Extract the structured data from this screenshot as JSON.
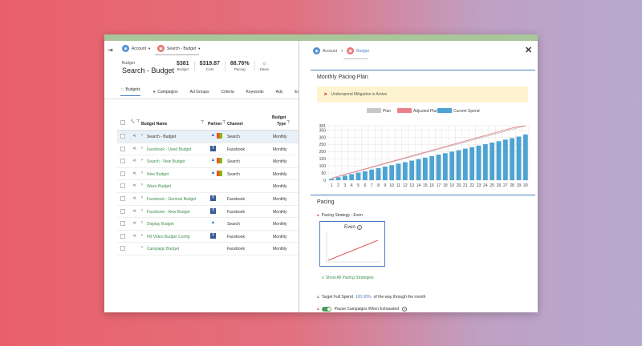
{
  "left_panel": {
    "breadcrumbs": [
      {
        "icon": "account-icon",
        "label": "Account"
      },
      {
        "icon": "budget-icon",
        "label": "Search - Budget"
      }
    ],
    "budget_label": "Budget",
    "budget_name": "Search - Budget",
    "metrics": [
      {
        "value": "$381",
        "label": "Budget"
      },
      {
        "value": "$319.87",
        "label": "Cost"
      },
      {
        "value": "88.76%",
        "label": "Pacing"
      },
      {
        "icon": "dawn-icon",
        "label": "Dawn"
      }
    ],
    "tabs": [
      {
        "label": "Budgets",
        "icon": "star-outline-icon",
        "active": true
      },
      {
        "label": "Campaigns",
        "icon": "star-icon"
      },
      {
        "label": "Ad Groups"
      },
      {
        "label": "Criteria"
      },
      {
        "label": "Keywords"
      },
      {
        "label": "Ads"
      },
      {
        "label": "Ex"
      }
    ],
    "table": {
      "headers": {
        "budget_name": "Budget Name",
        "partner": "Partner",
        "channel": "Channel",
        "budget_type_1": "Budget",
        "budget_type_2": "Type"
      },
      "rows": [
        {
          "name": "Search - Budget",
          "partner": [
            "ads",
            "ms"
          ],
          "channel": "Search",
          "type": "Monthly",
          "selected": true,
          "style": "dark",
          "share": true
        },
        {
          "name": "Facebook - Used Budget",
          "partner": [
            "fb"
          ],
          "channel": "Facebook",
          "type": "Monthly",
          "style": "green",
          "share": true
        },
        {
          "name": "Search - New Budget",
          "partner": [
            "ads",
            "ms"
          ],
          "channel": "Search",
          "type": "Monthly",
          "style": "green",
          "share": true
        },
        {
          "name": "New Budget",
          "partner": [
            "ads",
            "ms"
          ],
          "channel": "Search",
          "type": "Monthly",
          "style": "green",
          "share": true
        },
        {
          "name": "Waze Budget",
          "partner": [],
          "channel": "",
          "type": "Monthly",
          "style": "green",
          "share": true
        },
        {
          "name": "Facebook - General Budget",
          "partner": [
            "fb"
          ],
          "channel": "Facebook",
          "type": "Monthly",
          "style": "green",
          "share": true
        },
        {
          "name": "Facebook - New Budget",
          "partner": [
            "fb"
          ],
          "channel": "Facebook",
          "type": "Monthly",
          "style": "green",
          "share": true
        },
        {
          "name": "Display Budget",
          "partner": [
            "ads"
          ],
          "channel": "Search",
          "type": "Monthly",
          "style": "green",
          "share": true
        },
        {
          "name": "FB Video Budget Config",
          "partner": [
            "fb"
          ],
          "channel": "Facebook",
          "type": "Monthly",
          "style": "green",
          "share": true
        },
        {
          "name": "Campaign Budget",
          "partner": [],
          "channel": "Facebook",
          "type": "Monthly",
          "style": "green",
          "share": false
        }
      ]
    }
  },
  "right_panel": {
    "breadcrumbs": [
      {
        "icon": "account-icon",
        "label": "Account"
      },
      {
        "icon": "budget-icon",
        "label": "Budget"
      }
    ],
    "monthly_title": "Monthly Pacing Plan",
    "warning_text": "Underspend Mitigation is Active",
    "pacing_title": "Pacing",
    "pacing_strategy": "Pacing Strategy - Even",
    "even_label": "Even",
    "show_all_link": "Show All Pacing Strategies",
    "target_prefix": "Target Full Spend",
    "target_pct": "100.00%",
    "target_suffix": "of the way through the month",
    "pause_label": "Pause Campaigns When Exhausted"
  },
  "colors": {
    "plan": "#c8c8c8",
    "adjusted_plan": "#e9808a",
    "current_spend": "#4da3d3"
  },
  "chart_data": {
    "type": "bar",
    "legend": [
      "Plan",
      "Adjusted Plan",
      "Current Spend"
    ],
    "legend_position": "top-center",
    "categories": [
      "1",
      "2",
      "3",
      "4",
      "5",
      "6",
      "7",
      "8",
      "9",
      "10",
      "11",
      "12",
      "13",
      "14",
      "15",
      "16",
      "17",
      "18",
      "19",
      "20",
      "21",
      "22",
      "23",
      "24",
      "25",
      "26",
      "27",
      "28",
      "29",
      "30"
    ],
    "y_ticks": [
      "0",
      "50",
      "100",
      "150",
      "200",
      "250",
      "300",
      "350",
      "381"
    ],
    "ylim": [
      0,
      381
    ],
    "grid": true,
    "series": [
      {
        "name": "Plan",
        "kind": "line",
        "values": [
          12.7,
          25.4,
          38.1,
          50.8,
          63.5,
          76.2,
          88.9,
          101.6,
          114.3,
          127,
          139.7,
          152.4,
          165.1,
          177.8,
          190.5,
          203.2,
          215.9,
          228.6,
          241.3,
          254,
          266.7,
          279.4,
          292.1,
          304.8,
          317.5,
          330.2,
          342.9,
          355.6,
          368.3,
          381
        ]
      },
      {
        "name": "Adjusted Plan",
        "kind": "line",
        "values": [
          14,
          27,
          40,
          53,
          66,
          79,
          92,
          105,
          118,
          131,
          144,
          157,
          170,
          183,
          196,
          209,
          222,
          235,
          248,
          261,
          274,
          287,
          300,
          313,
          326,
          339,
          352,
          365,
          375,
          381
        ]
      },
      {
        "name": "Current Spend",
        "kind": "bar",
        "values": [
          10,
          21,
          32,
          42,
          53,
          63,
          74,
          84,
          95,
          105,
          116,
          126,
          137,
          147,
          158,
          168,
          179,
          189,
          200,
          210,
          221,
          231,
          242,
          252,
          263,
          273,
          284,
          294,
          305,
          320
        ]
      }
    ]
  }
}
